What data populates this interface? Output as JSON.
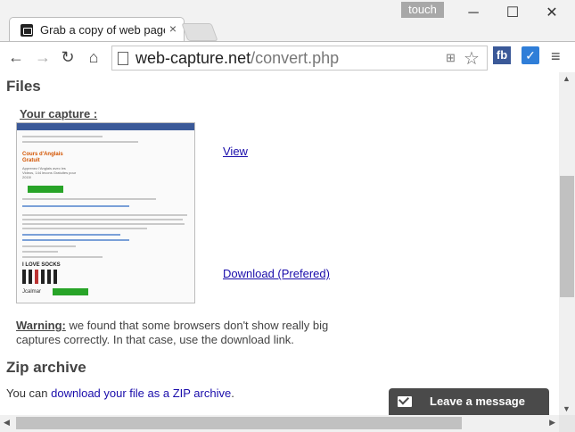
{
  "window": {
    "touch_label": "touch",
    "minimize": "─",
    "maximize": "☐",
    "close": "✕"
  },
  "tab": {
    "title": "Grab a copy of web page",
    "close": "×"
  },
  "toolbar": {
    "back": "←",
    "forward": "→",
    "reload": "↻",
    "home": "⌂",
    "url_domain": "web-capture.net",
    "url_path": "/convert.php",
    "star": "☆",
    "fb_ext": "fb",
    "check_ext": "✓",
    "menu": "≡"
  },
  "page": {
    "files_heading": "Files",
    "your_capture": "Your capture :",
    "view_link": "View",
    "download_link": "Download (Prefered)",
    "warning_label": "Warning:",
    "warning_text": " we found that some browsers don't show really big captures correctly. In that case, use the download link.",
    "zip_heading": "Zip archive",
    "zip_prefix": "You can ",
    "zip_link": "download your file as a ZIP archive",
    "zip_suffix": "."
  },
  "chat": {
    "label": "Leave a message"
  },
  "thumbnail": {
    "promo_title": "Cours d'Anglais Gratuit",
    "promo_sub": "Apprenez l'Anglais avec les Videos, 144 lecons Gratuites pour 2015!",
    "brand": "I LOVE SOCKS",
    "logo": "Jcalmar"
  }
}
